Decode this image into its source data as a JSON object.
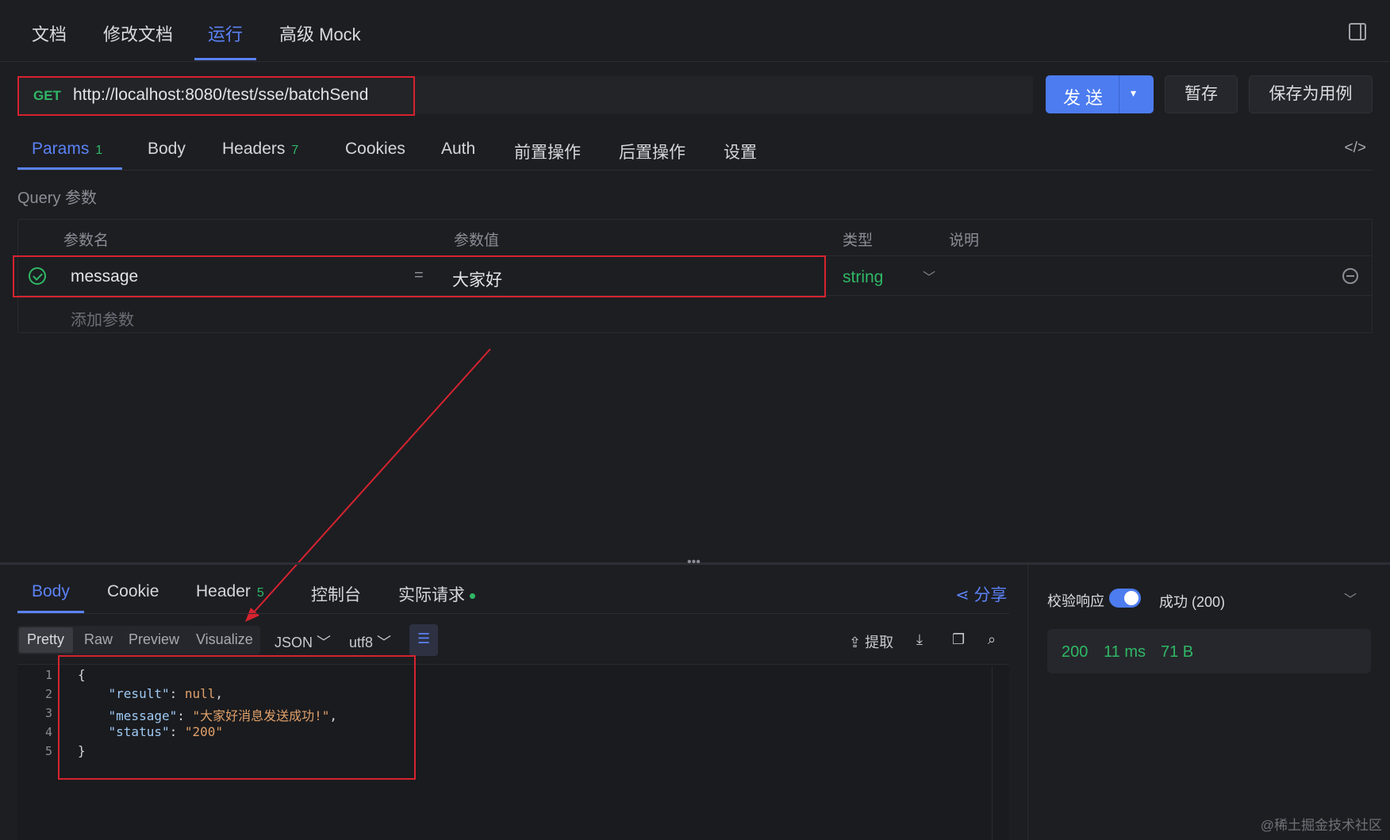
{
  "top_tabs": [
    {
      "label": "文档"
    },
    {
      "label": "修改文档"
    },
    {
      "label": "运行"
    },
    {
      "label": "高级 Mock"
    }
  ],
  "request": {
    "method": "GET",
    "url": "http://localhost:8080/test/sse/batchSend",
    "send_label": "发送",
    "save_draft_label": "暂存",
    "save_case_label": "保存为用例"
  },
  "req_tabs": [
    {
      "label": "Params",
      "badge": "1"
    },
    {
      "label": "Body"
    },
    {
      "label": "Headers",
      "badge": "7"
    },
    {
      "label": "Cookies"
    },
    {
      "label": "Auth"
    },
    {
      "label": "前置操作"
    },
    {
      "label": "后置操作"
    },
    {
      "label": "设置"
    }
  ],
  "query": {
    "section_label": "Query 参数",
    "headers": {
      "name": "参数名",
      "value": "参数值",
      "type": "类型",
      "desc": "说明"
    },
    "rows": [
      {
        "name": "message",
        "eq": "=",
        "value": "大家好",
        "type": "string"
      }
    ],
    "add_label": "添加参数"
  },
  "response": {
    "tabs": [
      {
        "label": "Body"
      },
      {
        "label": "Cookie"
      },
      {
        "label": "Header",
        "badge": "5"
      },
      {
        "label": "控制台"
      },
      {
        "label": "实际请求"
      }
    ],
    "share_label": "分享",
    "formats": [
      "Pretty",
      "Raw",
      "Preview",
      "Visualize"
    ],
    "type_select": "JSON",
    "encoding_select": "utf8",
    "extract_label": "提取",
    "code_lines": [
      {
        "no": "1",
        "text": "{"
      },
      {
        "no": "2",
        "key": "\"result\"",
        "val": "null",
        "tail": ","
      },
      {
        "no": "3",
        "key": "\"message\"",
        "val": "\"大家好消息发送成功!\"",
        "tail": ","
      },
      {
        "no": "4",
        "key": "\"status\"",
        "val": "\"200\"",
        "tail": ""
      },
      {
        "no": "5",
        "text": "}"
      }
    ]
  },
  "verify": {
    "label": "校验响应",
    "enabled": true,
    "result": "成功 (200)",
    "status": "200",
    "time": "11 ms",
    "size": "71 B"
  },
  "watermark": "@稀土掘金技术社区",
  "colors": {
    "accent": "#5b82f5",
    "success": "#2fb866",
    "highlight": "#d6232f",
    "background": "#1d1e22"
  }
}
